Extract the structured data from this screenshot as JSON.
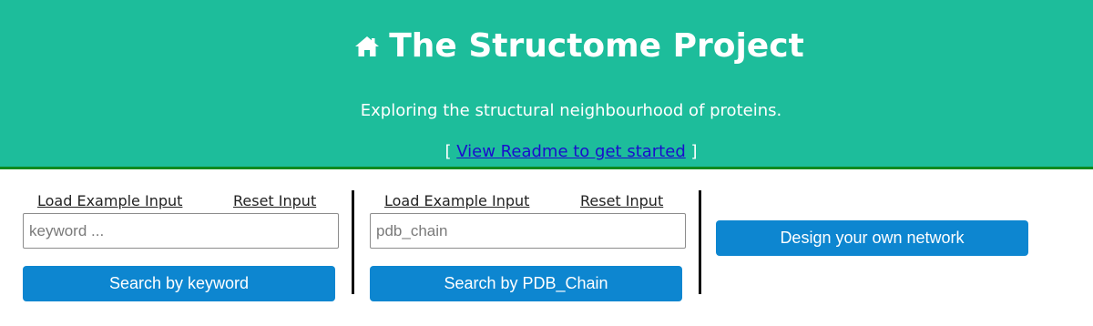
{
  "header": {
    "icon": "home-icon",
    "title": "The Structome Project",
    "subtitle": "Exploring the structural neighbourhood of proteins.",
    "readme_open_bracket": "[",
    "readme_link": "View Readme to get started",
    "readme_close_bracket": "]"
  },
  "keyword_panel": {
    "load_example": "Load Example Input",
    "reset": "Reset Input",
    "input_value": "",
    "input_placeholder": "keyword ...",
    "search_button": "Search by keyword"
  },
  "pdb_panel": {
    "load_example": "Load Example Input",
    "reset": "Reset Input",
    "input_value": "",
    "input_placeholder": "pdb_chain",
    "search_button": "Search by PDB_Chain"
  },
  "network_panel": {
    "design_button": "Design your own network"
  },
  "colors": {
    "header_bg": "#1dbd9b",
    "header_border": "#0d8a1f",
    "button_bg": "#0d86d0",
    "link": "#1a0dcc"
  }
}
